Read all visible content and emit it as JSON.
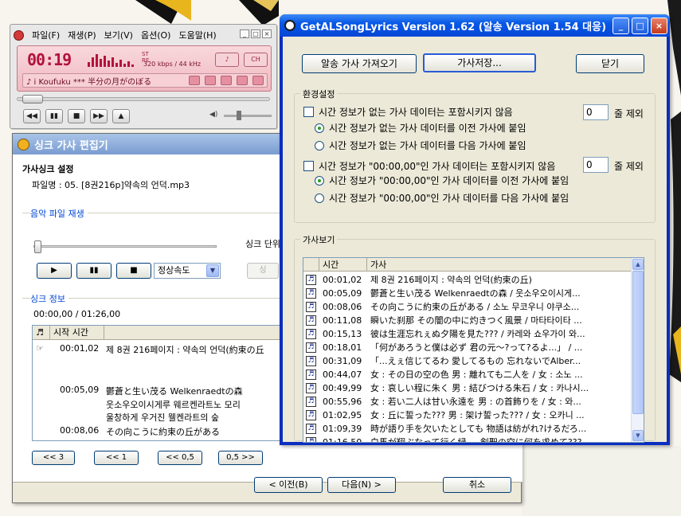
{
  "colors": {
    "xp_title": "#0758e6",
    "player_lcd": "#f0b8c0",
    "player_time": "#b3123c",
    "link_blue": "#0046d5"
  },
  "player": {
    "menu": [
      "파일(F)",
      "재생(P)",
      "보기(V)",
      "옵션(O)",
      "도움말(H)"
    ],
    "time": "00:19",
    "stereo": "ST\nRE",
    "bitrate": "320 kbps / 44 kHz",
    "btn_a": "♪",
    "btn_b": "CH",
    "now_playing": "♪  i Koufuku  ***  半分の月がのぼる",
    "controls": [
      "◀◀",
      "▮▮",
      "■",
      "▶▶",
      "▲"
    ],
    "wbtns": [
      "_",
      "□",
      "×"
    ]
  },
  "editor": {
    "title": "싱크 가사 편집기",
    "heading": "가사싱크 설정",
    "file_label": "파일명 : 05. [8권216p]약속의 언덕.mp3",
    "music_group": "음악 파일 재생",
    "sync_unit": "싱크 단위",
    "play_buttons": [
      "▶",
      "▮▮",
      "■"
    ],
    "speed": "정상속도",
    "hidden_btn": "싱",
    "sync_group": "싱크 정보",
    "range": "00:00,00 / 01:26,00",
    "grid_headers": [
      "♬",
      "시작 시간",
      ""
    ],
    "grid_rows": [
      {
        "icon": "☞",
        "time": "00:01,02",
        "lines": [
          "제 8권 216페이지 : 약속의 언덕(約束の丘"
        ]
      },
      {
        "icon": "",
        "time": "00:05,09",
        "lines": [
          "鬱蒼と生い茂る  Welkenraedtの森",
          "웃소우오이시게루 웨르켄라트노 모리",
          "울창하게 우거진 웰켄라트의 숲"
        ]
      },
      {
        "icon": "",
        "time": "00:08,06",
        "lines": [
          "その向こうに約束の丘がある"
        ]
      }
    ],
    "nav_buttons": [
      "<< 3",
      "<< 1",
      "<< 0,5",
      "0,5 >>"
    ],
    "footer": {
      "prev": "< 이전(B)",
      "next": "다음(N) >",
      "cancel": "취소"
    }
  },
  "lyrics_app": {
    "title": "GetALSongLyrics Version 1.62 (알송 Version 1.54 대응)",
    "title_buttons": [
      "_",
      "□",
      "×"
    ],
    "btn_fetch": "알송 가사 가져오기",
    "btn_save": "가사저장...",
    "btn_close": "닫기",
    "settings_group": "환경설정",
    "opt1": "시간 정보가 없는 가사 데이터는 포함시키지 않음",
    "opt1_value": "0",
    "opt1_unit": "줄 제외",
    "radio1a": "시간 정보가 없는 가사 데이터를 이전 가사에 붙임",
    "radio1b": "시간 정보가 없는 가사 데이터를 다음 가사에 붙임",
    "opt2": "시간 정보가 \"00:00,00\"인 가사 데이터는 포함시키지 않음",
    "opt2_value": "0",
    "opt2_unit": "줄 제외",
    "radio2a": "시간 정보가 \"00:00,00\"인 가사 데이터를 이전 가사에 붙임",
    "radio2b": "시간 정보가 \"00:00,00\"인 가사 데이터를 다음 가사에 붙임",
    "view_group": "가사보기",
    "col_time": "시간",
    "col_lyric": "가사",
    "rows": [
      {
        "time": "00:01,02",
        "text": "제 8권 216페이지 : 약속의 언덕(約束の丘)"
      },
      {
        "time": "00:05,09",
        "text": "鬱蒼と生い茂る  Welkenraedtの森 / 웃소우오이시게..."
      },
      {
        "time": "00:08,06",
        "text": "その向こうに約束の丘がある / 소노 무코우니 야쿠소..."
      },
      {
        "time": "00:11,08",
        "text": "瞬いた刹那  その闇の中に灼きつく風景 / 마타타이타 ..."
      },
      {
        "time": "00:15,13",
        "text": "彼は生涯忘れぇぬ夕陽を見た??? / 카레와 쇼우가이 와..."
      },
      {
        "time": "00:18,01",
        "text": "「何があろうと僕は必ず  君の元～?って?るよ...」 / ..."
      },
      {
        "time": "00:31,09",
        "text": "「...えぇ信じてるわ  愛してるもの  忘れないでAlber..."
      },
      {
        "time": "00:44,07",
        "text": "女 : その日の空の色  男 : 離れても二人を / 女 : 소노 ..."
      },
      {
        "time": "00:49,99",
        "text": "女 : 哀しい程に朱く 男 : 結びつける朱石 / 女 : 카나시..."
      },
      {
        "time": "00:55,96",
        "text": "女 : 若い二人は甘い永遠を  男 : の首飾りを / 女 : 와..."
      },
      {
        "time": "01:02,95",
        "text": "女 : 丘に誓った???  男 : 架け誓った??? / 女 : 오카니 ..."
      },
      {
        "time": "01:09,39",
        "text": "時が語り手を欠いたとしても  物語は紡がれ?けるだろ..."
      },
      {
        "time": "01:16,50",
        "text": "白馬が翔ぶなって行く緑 ... 剣聖の空に何を求めて???"
      }
    ]
  }
}
